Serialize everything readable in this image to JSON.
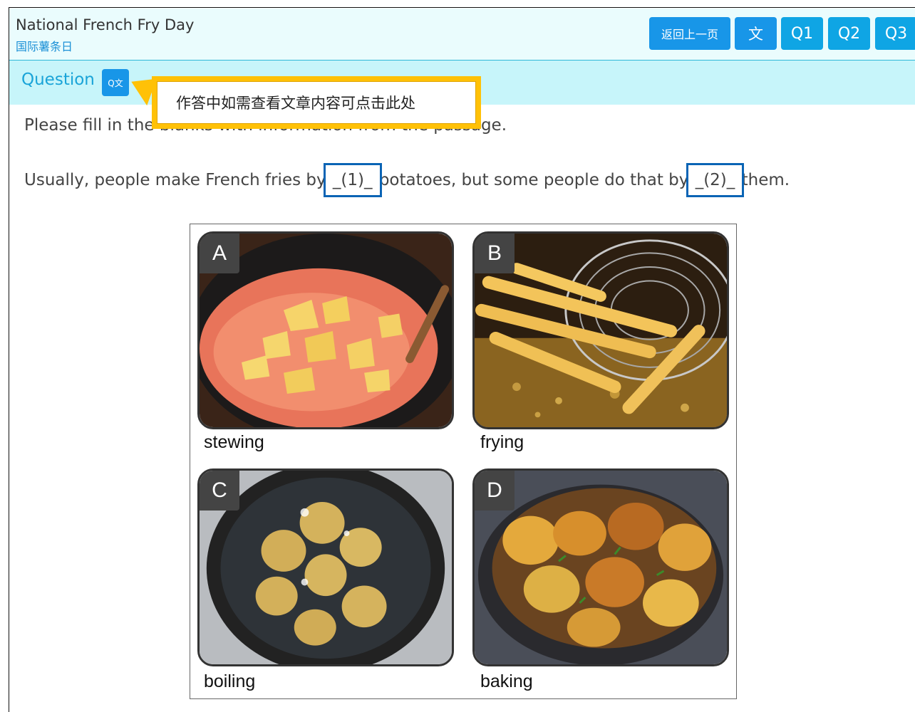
{
  "header": {
    "title": "National French Fry Day",
    "subtitle": "国际薯条日",
    "buttons": {
      "back": "返回上一页",
      "text": "文",
      "q1": "Q1",
      "q2": "Q2",
      "q3": "Q3"
    }
  },
  "question_bar": {
    "label": "Question",
    "icon_text": "Q文"
  },
  "tooltip": {
    "text": "作答中如需查看文章内容可点击此处"
  },
  "question": {
    "instruction": "Please fill in the blanks with information from the passage.",
    "sentence_part1": "Usually, people make French fries by ",
    "blank1": "_(1)_",
    "sentence_part2": " potatoes, but some people do that by ",
    "blank2": "_(2)_",
    "sentence_part3": " them."
  },
  "options": [
    {
      "letter": "A",
      "caption": "stewing"
    },
    {
      "letter": "B",
      "caption": "frying"
    },
    {
      "letter": "C",
      "caption": "boiling"
    },
    {
      "letter": "D",
      "caption": "baking"
    }
  ],
  "colors": {
    "accent": "#1896e8",
    "header_bg": "#eafcfd",
    "question_bar_bg": "#c7f5fa",
    "tooltip": "#ffc107",
    "blank_outline": "#0a64b5"
  }
}
